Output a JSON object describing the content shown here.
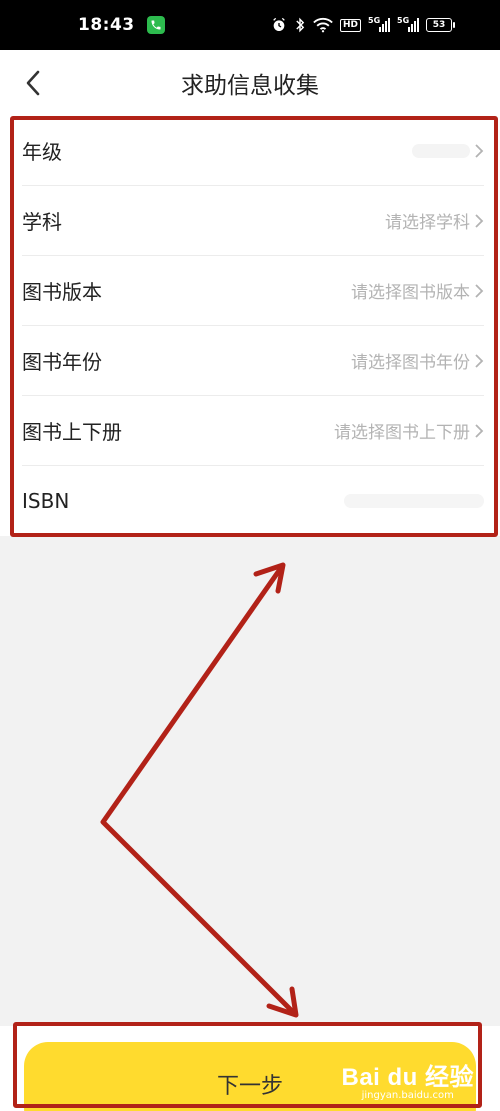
{
  "status_bar": {
    "time": "18:43",
    "battery": "53",
    "network_tags": [
      "5G",
      "5G"
    ],
    "hd_label": "HD",
    "icons": [
      "call-icon",
      "alarm-icon",
      "bluetooth-icon",
      "wifi-icon",
      "hd-icon",
      "signal-icon",
      "signal-icon",
      "battery-icon"
    ]
  },
  "nav": {
    "title": "求助信息收集",
    "back_icon": "chevron-left-icon"
  },
  "form": {
    "rows": [
      {
        "label": "年级",
        "value": "",
        "placeholder": ""
      },
      {
        "label": "学科",
        "placeholder": "请选择学科"
      },
      {
        "label": "图书版本",
        "placeholder": "请选择图书版本"
      },
      {
        "label": "图书年份",
        "placeholder": "请选择图书年份"
      },
      {
        "label": "图书上下册",
        "placeholder": "请选择图书上下册"
      },
      {
        "label": "ISBN",
        "value": ""
      }
    ]
  },
  "actions": {
    "next_label": "下一步"
  },
  "watermark": {
    "logo": "Bai du 经验",
    "sub": "jingyan.baidu.com"
  },
  "colors": {
    "accent_yellow": "#ffdb2e",
    "annotation_red": "#b22218",
    "placeholder_gray": "#b3b3b3",
    "background": "#f2f2f2"
  }
}
